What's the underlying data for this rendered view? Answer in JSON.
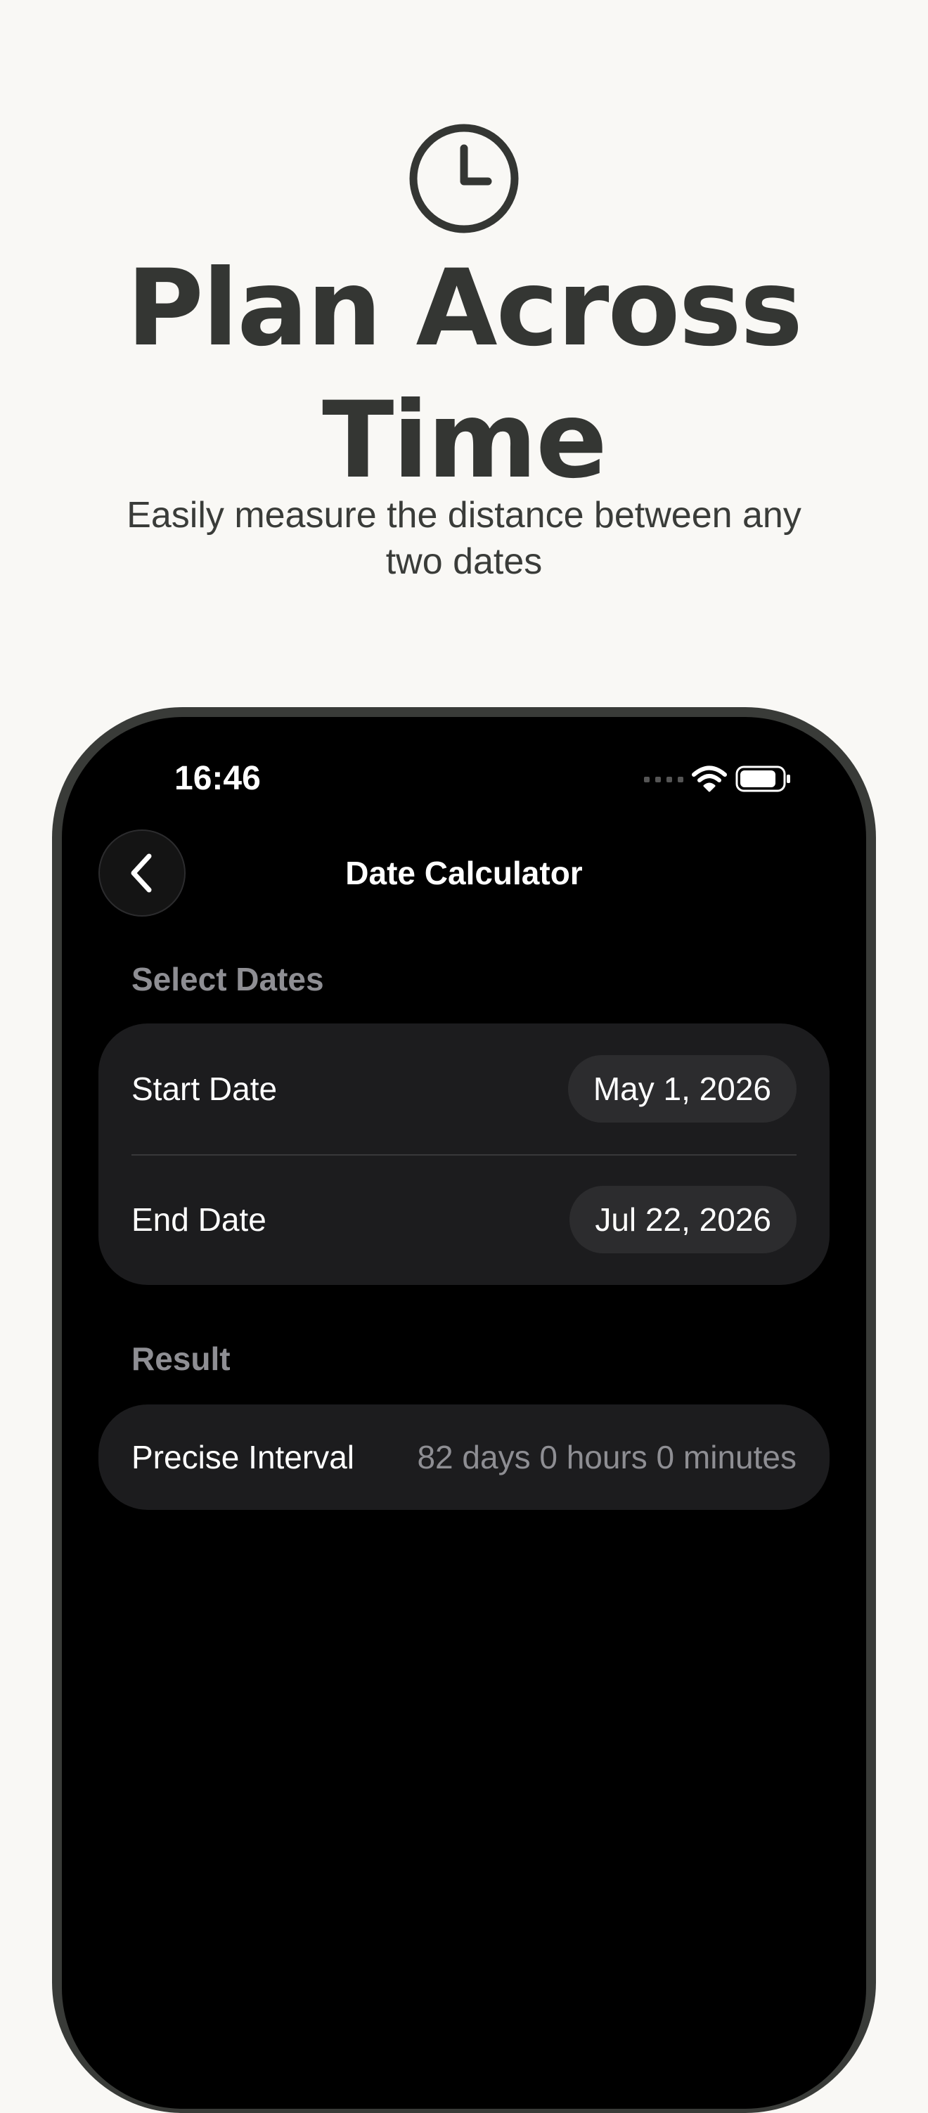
{
  "hero": {
    "icon": "clock-icon",
    "title": "Plan Across Time",
    "subtitle": "Easily measure the distance between any two dates"
  },
  "status_bar": {
    "time": "16:46",
    "icons": [
      "signal-icon",
      "wifi-icon",
      "battery-icon"
    ]
  },
  "nav": {
    "back_icon": "chevron-left-icon",
    "title": "Date Calculator"
  },
  "select_dates": {
    "section_label": "Select Dates",
    "start_label": "Start Date",
    "start_value": "May 1, 2026",
    "end_label": "End Date",
    "end_value": "Jul 22, 2026"
  },
  "result": {
    "section_label": "Result",
    "interval_label": "Precise Interval",
    "interval_value": "82 days 0 hours 0 minutes"
  },
  "colors": {
    "background": "#f9f8f5",
    "hero_text": "#343633",
    "phone_frame": "#393b38",
    "screen": "#000000",
    "card": "#1c1c1e",
    "pill": "#2c2c2e",
    "secondary_text": "#8e8e93"
  }
}
